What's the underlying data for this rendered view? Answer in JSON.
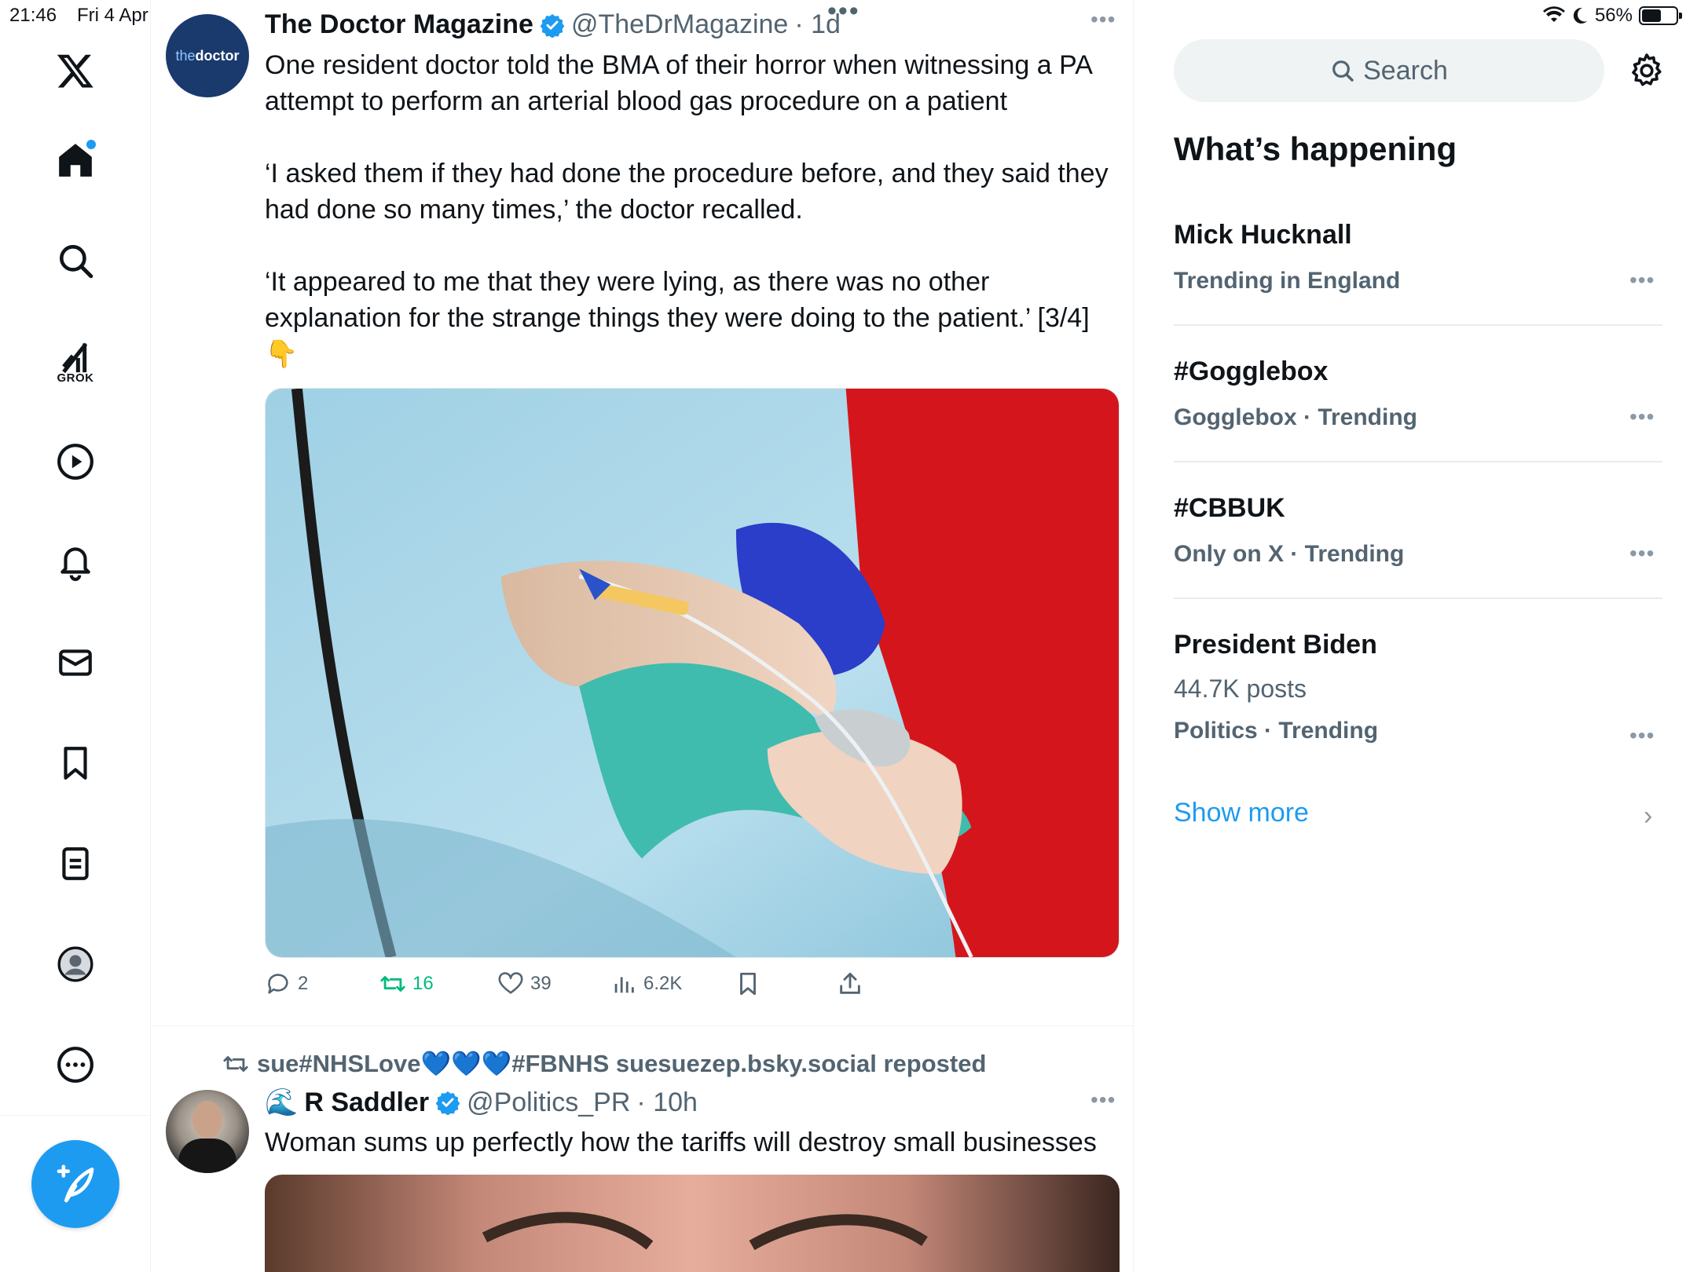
{
  "status_bar": {
    "time": "21:46",
    "date": "Fri 4 Apr",
    "battery": "56%",
    "battery_level": 0.56
  },
  "nav": {
    "logo": "x-logo-icon",
    "grok_label": "GROK",
    "items": [
      "home-icon",
      "search-icon",
      "grok-icon",
      "video-icon",
      "bell-icon",
      "mail-icon",
      "bookmark-icon",
      "list-icon",
      "profile-icon",
      "more-icon"
    ],
    "compose": "compose-icon"
  },
  "tweets": [
    {
      "avatar_text_a": "the",
      "avatar_text_b": "doctor",
      "name": "The Doctor Magazine",
      "handle": "@TheDrMagazine",
      "time": "· 1d",
      "text_1": "One resident doctor told the BMA of their horror when witnessing a PA attempt to perform an arterial blood gas procedure on a patient",
      "text_2": "‘I asked them if they had done the procedure before, and they said they had done so many times,’ the doctor recalled.",
      "text_3": "‘It appeared to me that they were lying, as there was no other explanation for the strange things they were doing to the patient.’ [3/4]",
      "text_emoji": "👇",
      "actions": {
        "replies": "2",
        "reposts": "16",
        "likes": "39",
        "views": "6.2K"
      }
    },
    {
      "repost_by": "sue#NHSLove💙💙💙#FBNHS suesuezep.bsky.social reposted",
      "name_emoji": "🌊",
      "name": "R Saddler",
      "handle": "@Politics_PR",
      "time": "· 10h",
      "text": "Woman sums up perfectly how the tariffs will destroy small businesses"
    }
  ],
  "sidebar": {
    "search_placeholder": "Search",
    "title": "What’s happening",
    "trends": [
      {
        "name": "Mick Hucknall",
        "meta": "Trending in England"
      },
      {
        "name": "#Gogglebox",
        "meta": "Gogglebox · Trending"
      },
      {
        "name": "#CBBUK",
        "meta": "Only on X · Trending"
      },
      {
        "name": "President Biden",
        "posts": "44.7K posts",
        "meta": "Politics · Trending"
      }
    ],
    "show_more": "Show more"
  },
  "colors": {
    "accent": "#1d9bf0",
    "repost_green": "#00ba7c",
    "muted": "#536471"
  }
}
